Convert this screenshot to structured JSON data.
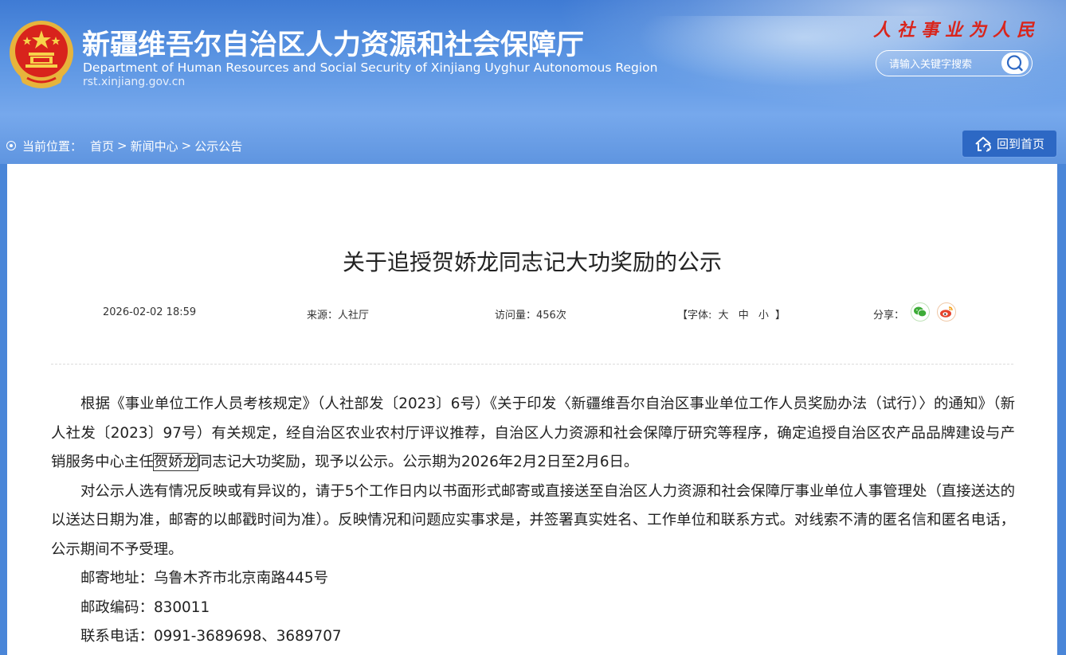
{
  "header": {
    "title_cn": "新疆维吾尔自治区人力资源和社会保障厅",
    "title_en": "Department of Human Resources and Social Security of Xinjiang Uyghur Autonomous Region",
    "url": "rst.xinjiang.gov.cn",
    "slogan": "人社事业为人民",
    "search_placeholder": "请输入关键字搜索",
    "colors": {
      "background": "#4a86d8",
      "slogan": "#d9251c"
    }
  },
  "breadcrumb": {
    "label": "当前位置：",
    "items": [
      "首页",
      "新闻中心",
      "公示公告"
    ],
    "separator": ">"
  },
  "home_button": {
    "label": "回到首页"
  },
  "article": {
    "title": "关于追授贺娇龙同志记大功奖励的公示",
    "date": "2026-02-02 18:59",
    "source": "来源：人社厅",
    "visits": "访问量：456次",
    "font_label_open": "【字体:",
    "font_large": "大",
    "font_medium": "中",
    "font_small": "小",
    "font_label_close": "】",
    "share_label": "分享：",
    "para1_before": "根据《事业单位工作人员考核规定》（人社部发〔2023〕6号）《关于印发〈新疆维吾尔自治区事业单位工作人员奖励办法（试行）〉的通知》（新人社发〔2023〕97号）有关规定，经自治区农业农村厅评议推荐，自治区人力资源和社会保障厅研究等程序，确定追授自治区农产品品牌建设与产销服务中心主任",
    "para1_name": "贺娇龙",
    "para1_after": "同志记大功奖励，现予以公示。公示期为2026年2月2日至2月6日。",
    "para2": "对公示人选有情况反映或有异议的，请于5个工作日内以书面形式邮寄或直接送至自治区人力资源和社会保障厅事业单位人事管理处（直接送达的以送达日期为准，邮寄的以邮戳时间为准）。反映情况和问题应实事求是，并签署真实姓名、工作单位和联系方式。对线索不清的匿名信和匿名电话，公示期间不予受理。",
    "address": "邮寄地址：乌鲁木齐市北京南路445号",
    "postcode": "邮政编码：830011",
    "phone": "联系电话：0991-3689698、3689707"
  }
}
